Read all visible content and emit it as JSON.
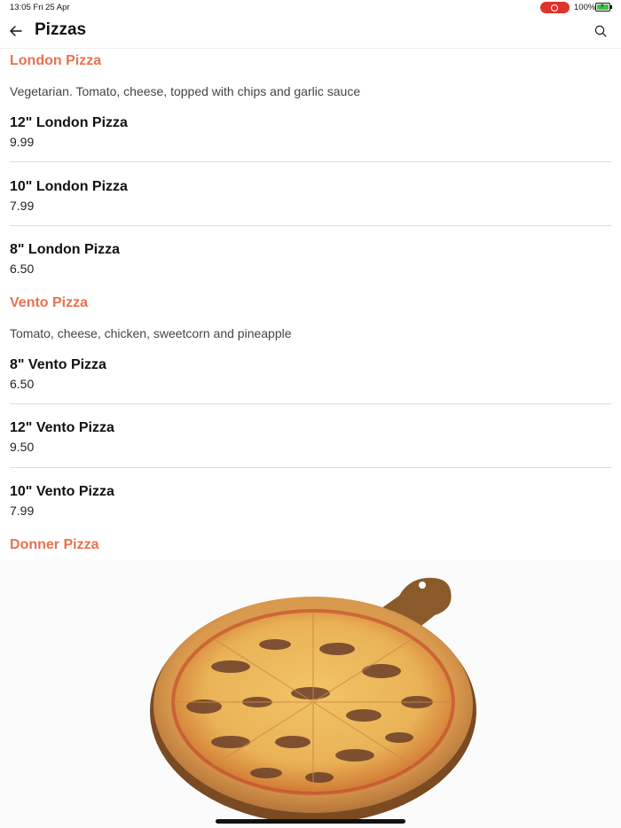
{
  "status_bar": {
    "time": "13:05  Fri 25 Apr",
    "battery_percent": "100%",
    "battery_level": 1.0,
    "recording_color": "#e0332c"
  },
  "nav": {
    "title": "Pizzas",
    "back_icon": "arrow-left-icon",
    "search_icon": "search-icon"
  },
  "accent_color": "#e8714f",
  "sections": [
    {
      "title": "London Pizza",
      "description": "Vegetarian. Tomato, cheese, topped with chips and garlic sauce",
      "items": [
        {
          "name": "12\" London Pizza",
          "price": "9.99"
        },
        {
          "name": "10\" London Pizza",
          "price": "7.99"
        },
        {
          "name": "8\" London Pizza",
          "price": "6.50"
        }
      ]
    },
    {
      "title": "Vento Pizza",
      "description": "Tomato, cheese, chicken, sweetcorn and pineapple",
      "items": [
        {
          "name": "8\" Vento Pizza",
          "price": "6.50"
        },
        {
          "name": "12\" Vento Pizza",
          "price": "9.50"
        },
        {
          "name": "10\" Vento Pizza",
          "price": "7.99"
        }
      ]
    },
    {
      "title": "Donner Pizza"
    }
  ]
}
